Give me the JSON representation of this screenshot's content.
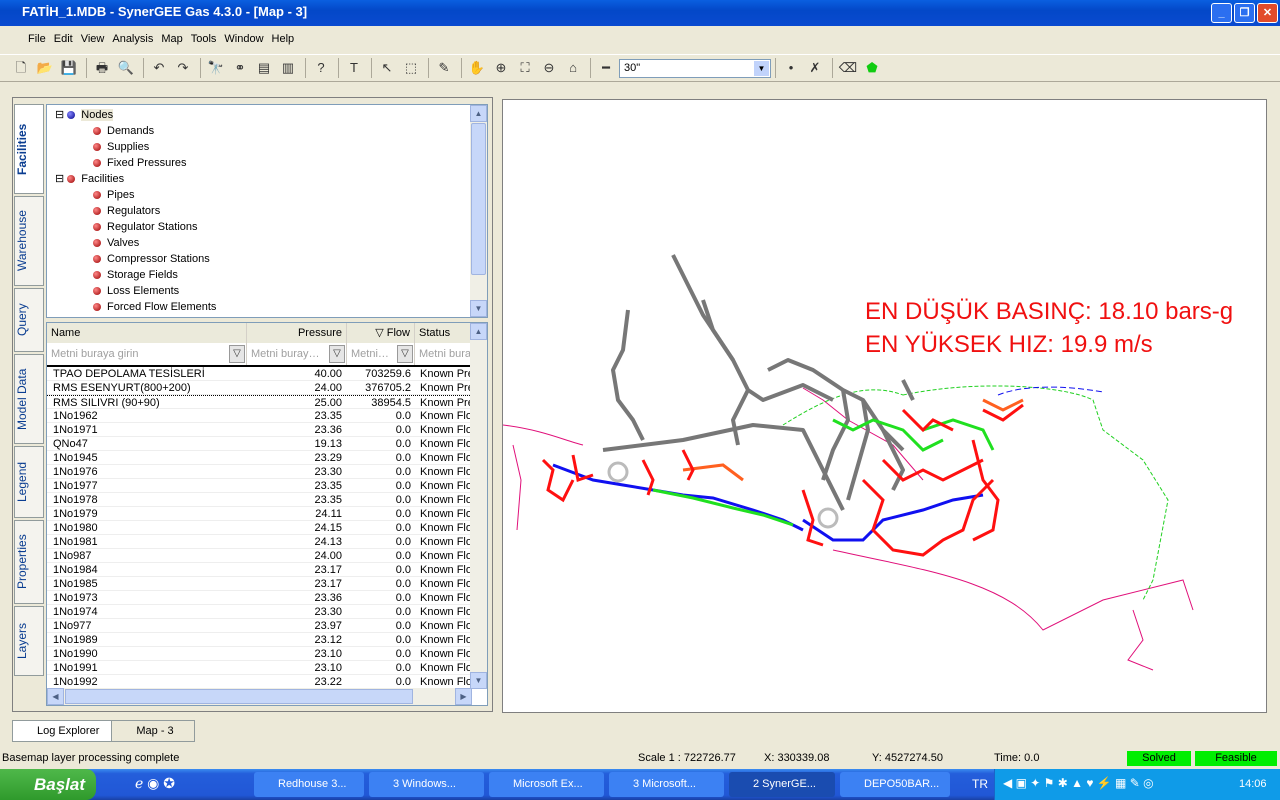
{
  "window": {
    "title": "FATİH_1.MDB - SynerGEE Gas 4.3.0 - [Map - 3]"
  },
  "menu": [
    "File",
    "Edit",
    "View",
    "Analysis",
    "Map",
    "Tools",
    "Window",
    "Help"
  ],
  "toolbar": {
    "zoom_value": "30\""
  },
  "vertical_tabs": [
    "Facilities",
    "Warehouse",
    "Query",
    "Model Data",
    "Legend",
    "Properties",
    "Layers"
  ],
  "tree": {
    "nodes_label": "Nodes",
    "node_children": [
      "Demands",
      "Supplies",
      "Fixed Pressures"
    ],
    "facilities_label": "Facilities",
    "facility_children": [
      "Pipes",
      "Regulators",
      "Regulator Stations",
      "Valves",
      "Compressor Stations",
      "Storage Fields",
      "Loss Elements",
      "Forced Flow Elements"
    ]
  },
  "grid": {
    "columns": [
      "Name",
      "Pressure",
      "Flow",
      "Status"
    ],
    "filters": [
      "Metni buraya girin",
      "Metni buray…",
      "Metni…",
      "Metni bura"
    ],
    "rows": [
      [
        "TPAO DEPOLAMA TESİSLERİ",
        "40.00",
        "703259.6",
        "Known Pre"
      ],
      [
        "RMS ESENYURT(800+200)",
        "24.00",
        "376705.2",
        "Known Pre"
      ],
      [
        "RMS SILIVRI (90+90)",
        "25.00",
        "38954.5",
        "Known Pre"
      ],
      [
        "1No1962",
        "23.35",
        "0.0",
        "Known Flo"
      ],
      [
        "1No1971",
        "23.36",
        "0.0",
        "Known Flo"
      ],
      [
        "QNo47",
        "19.13",
        "0.0",
        "Known Flo"
      ],
      [
        "1No1945",
        "23.29",
        "0.0",
        "Known Flo"
      ],
      [
        "1No1976",
        "23.30",
        "0.0",
        "Known Flo"
      ],
      [
        "1No1977",
        "23.35",
        "0.0",
        "Known Flo"
      ],
      [
        "1No1978",
        "23.35",
        "0.0",
        "Known Flo"
      ],
      [
        "1No1979",
        "24.11",
        "0.0",
        "Known Flo"
      ],
      [
        "1No1980",
        "24.15",
        "0.0",
        "Known Flo"
      ],
      [
        "1No1981",
        "24.13",
        "0.0",
        "Known Flo"
      ],
      [
        "1No987",
        "24.00",
        "0.0",
        "Known Flo"
      ],
      [
        "1No1984",
        "23.17",
        "0.0",
        "Known Flo"
      ],
      [
        "1No1985",
        "23.17",
        "0.0",
        "Known Flo"
      ],
      [
        "1No1973",
        "23.36",
        "0.0",
        "Known Flo"
      ],
      [
        "1No1974",
        "23.30",
        "0.0",
        "Known Flo"
      ],
      [
        "1No977",
        "23.97",
        "0.0",
        "Known Flo"
      ],
      [
        "1No1989",
        "23.12",
        "0.0",
        "Known Flo"
      ],
      [
        "1No1990",
        "23.10",
        "0.0",
        "Known Flo"
      ],
      [
        "1No1991",
        "23.10",
        "0.0",
        "Known Flo"
      ],
      [
        "1No1992",
        "23.22",
        "0.0",
        "Known Flo"
      ]
    ]
  },
  "map": {
    "annotation_1": "EN DÜŞÜK BASINÇ: 18.10 bars-g",
    "annotation_2": "EN YÜKSEK HIZ: 19.9 m/s",
    "annotation_color": "#f01010"
  },
  "bottom_tabs": [
    "Log Explorer",
    "Map - 3"
  ],
  "status": {
    "message": "Basemap layer processing complete",
    "scale": "Scale  1 : 722726.77",
    "x": "X: 330339.08",
    "y": "Y: 4527274.50",
    "time": "Time: 0.0",
    "solved": "Solved",
    "feasible": "Feasible"
  },
  "taskbar": {
    "start": "Başlat",
    "tasks": [
      "Redhouse 3...",
      "3 Windows...",
      "Microsoft Ex...",
      "3 Microsoft...",
      "2 SynerGE...",
      "DEPO50BAR..."
    ],
    "lang": "TR",
    "clock": "14:06"
  }
}
